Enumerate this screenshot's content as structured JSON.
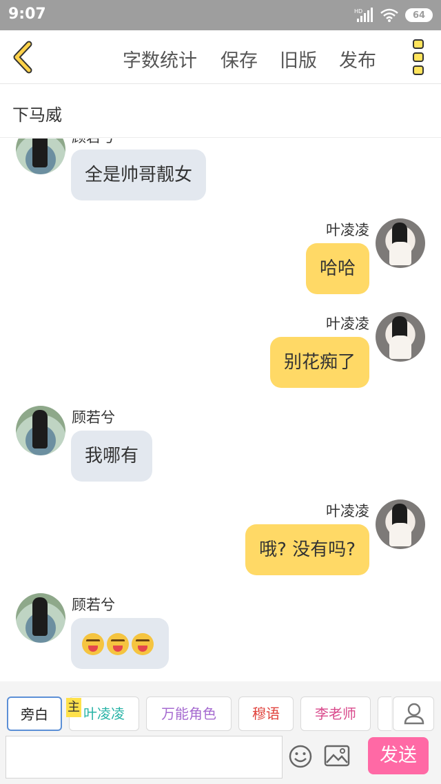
{
  "status_bar": {
    "time": "9:07",
    "network": "HD",
    "battery": "64"
  },
  "toolbar": {
    "items": [
      "字数统计",
      "保存",
      "旧版",
      "发布"
    ]
  },
  "title": "下马威",
  "messages": [
    {
      "side": "left",
      "name": "顾若兮",
      "text": "全是帅哥靓女"
    },
    {
      "side": "right",
      "name": "叶凌凌",
      "text": "哈哈"
    },
    {
      "side": "right",
      "name": "叶凌凌",
      "text": "别花痴了"
    },
    {
      "side": "left",
      "name": "顾若兮",
      "text": "我哪有"
    },
    {
      "side": "right",
      "name": "叶凌凌",
      "text": "哦? 没有吗?"
    },
    {
      "side": "left",
      "name": "顾若兮",
      "text": "",
      "emoji_count": 3
    }
  ],
  "roles": [
    {
      "label": "旁白",
      "color": "#555555",
      "selected": true
    },
    {
      "label": "叶凌凌",
      "color": "#27b3a6",
      "host": true
    },
    {
      "label": "万能角色",
      "color": "#a56ad0"
    },
    {
      "label": "穆语",
      "color": "#e0423c"
    },
    {
      "label": "李老师",
      "color": "#d94a8c"
    }
  ],
  "host_badge": "主",
  "input": {
    "placeholder": "",
    "value": ""
  },
  "send_label": "发送",
  "colors": {
    "accent": "#ffd966",
    "send": "#ff69a5",
    "left_bubble": "#e3e8ef"
  }
}
